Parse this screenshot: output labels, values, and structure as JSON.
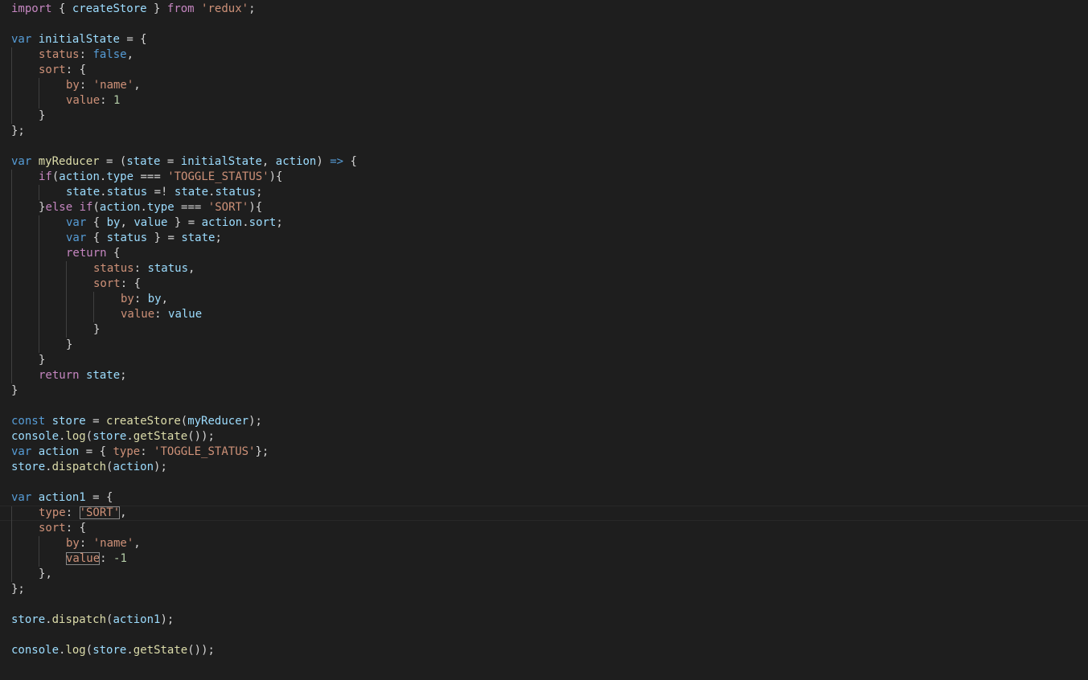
{
  "editor": {
    "colors": {
      "background": "#1e1e1e",
      "default": "#d4d4d4",
      "keyword": "#569cd6",
      "control": "#c586c0",
      "variable": "#9cdcfe",
      "function": "#dcdcaa",
      "string": "#ce9178",
      "number": "#b5cea8",
      "property": "#ce9178",
      "indent_guide": "#404040"
    },
    "current_line": 33,
    "bracket_match": {
      "line": 33,
      "token": 2
    },
    "bracket_match_end": {
      "line": 36,
      "token": 0
    },
    "lines": [
      {
        "indent": 0,
        "tokens": [
          [
            "control",
            "import"
          ],
          [
            "default",
            " { "
          ],
          [
            "variable",
            "createStore"
          ],
          [
            "default",
            " } "
          ],
          [
            "control",
            "from"
          ],
          [
            "default",
            " "
          ],
          [
            "string",
            "'redux'"
          ],
          [
            "default",
            ";"
          ]
        ]
      },
      {
        "indent": 0,
        "tokens": []
      },
      {
        "indent": 0,
        "tokens": [
          [
            "keyword",
            "var"
          ],
          [
            "default",
            " "
          ],
          [
            "variable",
            "initialState"
          ],
          [
            "default",
            " = {"
          ]
        ]
      },
      {
        "indent": 1,
        "tokens": [
          [
            "property",
            "status"
          ],
          [
            "default",
            ": "
          ],
          [
            "keyword",
            "false"
          ],
          [
            "default",
            ","
          ]
        ]
      },
      {
        "indent": 1,
        "tokens": [
          [
            "property",
            "sort"
          ],
          [
            "default",
            ": {"
          ]
        ]
      },
      {
        "indent": 2,
        "tokens": [
          [
            "property",
            "by"
          ],
          [
            "default",
            ": "
          ],
          [
            "string",
            "'name'"
          ],
          [
            "default",
            ","
          ]
        ]
      },
      {
        "indent": 2,
        "tokens": [
          [
            "property",
            "value"
          ],
          [
            "default",
            ": "
          ],
          [
            "number",
            "1"
          ]
        ]
      },
      {
        "indent": 1,
        "tokens": [
          [
            "default",
            "}"
          ]
        ]
      },
      {
        "indent": 0,
        "tokens": [
          [
            "default",
            "};"
          ]
        ]
      },
      {
        "indent": 0,
        "tokens": []
      },
      {
        "indent": 0,
        "tokens": [
          [
            "keyword",
            "var"
          ],
          [
            "default",
            " "
          ],
          [
            "function",
            "myReducer"
          ],
          [
            "default",
            " = ("
          ],
          [
            "variable",
            "state"
          ],
          [
            "default",
            " = "
          ],
          [
            "variable",
            "initialState"
          ],
          [
            "default",
            ", "
          ],
          [
            "variable",
            "action"
          ],
          [
            "default",
            ") "
          ],
          [
            "keyword",
            "=>"
          ],
          [
            "default",
            " {"
          ]
        ]
      },
      {
        "indent": 1,
        "tokens": [
          [
            "control",
            "if"
          ],
          [
            "default",
            "("
          ],
          [
            "variable",
            "action"
          ],
          [
            "default",
            "."
          ],
          [
            "variable",
            "type"
          ],
          [
            "default",
            " === "
          ],
          [
            "string",
            "'TOGGLE_STATUS'"
          ],
          [
            "default",
            "){"
          ]
        ]
      },
      {
        "indent": 2,
        "tokens": [
          [
            "variable",
            "state"
          ],
          [
            "default",
            "."
          ],
          [
            "variable",
            "status"
          ],
          [
            "default",
            " =! "
          ],
          [
            "variable",
            "state"
          ],
          [
            "default",
            "."
          ],
          [
            "variable",
            "status"
          ],
          [
            "default",
            ";"
          ]
        ]
      },
      {
        "indent": 1,
        "tokens": [
          [
            "default",
            "}"
          ],
          [
            "control",
            "else"
          ],
          [
            "default",
            " "
          ],
          [
            "control",
            "if"
          ],
          [
            "default",
            "("
          ],
          [
            "variable",
            "action"
          ],
          [
            "default",
            "."
          ],
          [
            "variable",
            "type"
          ],
          [
            "default",
            " === "
          ],
          [
            "string",
            "'SORT'"
          ],
          [
            "default",
            "){"
          ]
        ]
      },
      {
        "indent": 2,
        "tokens": [
          [
            "keyword",
            "var"
          ],
          [
            "default",
            " { "
          ],
          [
            "variable",
            "by"
          ],
          [
            "default",
            ", "
          ],
          [
            "variable",
            "value"
          ],
          [
            "default",
            " } = "
          ],
          [
            "variable",
            "action"
          ],
          [
            "default",
            "."
          ],
          [
            "variable",
            "sort"
          ],
          [
            "default",
            ";"
          ]
        ]
      },
      {
        "indent": 2,
        "tokens": [
          [
            "keyword",
            "var"
          ],
          [
            "default",
            " { "
          ],
          [
            "variable",
            "status"
          ],
          [
            "default",
            " } = "
          ],
          [
            "variable",
            "state"
          ],
          [
            "default",
            ";"
          ]
        ]
      },
      {
        "indent": 2,
        "tokens": [
          [
            "control",
            "return"
          ],
          [
            "default",
            " {"
          ]
        ]
      },
      {
        "indent": 3,
        "tokens": [
          [
            "property",
            "status"
          ],
          [
            "default",
            ": "
          ],
          [
            "variable",
            "status"
          ],
          [
            "default",
            ","
          ]
        ]
      },
      {
        "indent": 3,
        "tokens": [
          [
            "property",
            "sort"
          ],
          [
            "default",
            ": {"
          ]
        ]
      },
      {
        "indent": 4,
        "tokens": [
          [
            "property",
            "by"
          ],
          [
            "default",
            ": "
          ],
          [
            "variable",
            "by"
          ],
          [
            "default",
            ","
          ]
        ]
      },
      {
        "indent": 4,
        "tokens": [
          [
            "property",
            "value"
          ],
          [
            "default",
            ": "
          ],
          [
            "variable",
            "value"
          ]
        ]
      },
      {
        "indent": 3,
        "tokens": [
          [
            "default",
            "}"
          ]
        ]
      },
      {
        "indent": 2,
        "tokens": [
          [
            "default",
            "}"
          ]
        ]
      },
      {
        "indent": 1,
        "tokens": [
          [
            "default",
            "}"
          ]
        ]
      },
      {
        "indent": 1,
        "tokens": [
          [
            "control",
            "return"
          ],
          [
            "default",
            " "
          ],
          [
            "variable",
            "state"
          ],
          [
            "default",
            ";"
          ]
        ]
      },
      {
        "indent": 0,
        "tokens": [
          [
            "default",
            "}"
          ]
        ]
      },
      {
        "indent": 0,
        "tokens": []
      },
      {
        "indent": 0,
        "tokens": [
          [
            "keyword",
            "const"
          ],
          [
            "default",
            " "
          ],
          [
            "variable",
            "store"
          ],
          [
            "default",
            " = "
          ],
          [
            "function",
            "createStore"
          ],
          [
            "default",
            "("
          ],
          [
            "variable",
            "myReducer"
          ],
          [
            "default",
            ");"
          ]
        ]
      },
      {
        "indent": 0,
        "tokens": [
          [
            "variable",
            "console"
          ],
          [
            "default",
            "."
          ],
          [
            "function",
            "log"
          ],
          [
            "default",
            "("
          ],
          [
            "variable",
            "store"
          ],
          [
            "default",
            "."
          ],
          [
            "function",
            "getState"
          ],
          [
            "default",
            "());"
          ]
        ]
      },
      {
        "indent": 0,
        "tokens": [
          [
            "keyword",
            "var"
          ],
          [
            "default",
            " "
          ],
          [
            "variable",
            "action"
          ],
          [
            "default",
            " = { "
          ],
          [
            "property",
            "type"
          ],
          [
            "default",
            ": "
          ],
          [
            "string",
            "'TOGGLE_STATUS'"
          ],
          [
            "default",
            "};"
          ]
        ]
      },
      {
        "indent": 0,
        "tokens": [
          [
            "variable",
            "store"
          ],
          [
            "default",
            "."
          ],
          [
            "function",
            "dispatch"
          ],
          [
            "default",
            "("
          ],
          [
            "variable",
            "action"
          ],
          [
            "default",
            ");"
          ]
        ]
      },
      {
        "indent": 0,
        "tokens": []
      },
      {
        "indent": 0,
        "tokens": [
          [
            "keyword",
            "var"
          ],
          [
            "default",
            " "
          ],
          [
            "variable",
            "action1"
          ],
          [
            "default",
            " = {"
          ]
        ]
      },
      {
        "indent": 1,
        "tokens": [
          [
            "property",
            "type"
          ],
          [
            "default",
            ": "
          ],
          [
            "string",
            "'SORT'"
          ],
          [
            "default",
            ","
          ]
        ]
      },
      {
        "indent": 1,
        "tokens": [
          [
            "property",
            "sort"
          ],
          [
            "default",
            ": "
          ],
          [
            "default",
            "{"
          ]
        ]
      },
      {
        "indent": 2,
        "tokens": [
          [
            "property",
            "by"
          ],
          [
            "default",
            ": "
          ],
          [
            "string",
            "'name'"
          ],
          [
            "default",
            ","
          ]
        ]
      },
      {
        "indent": 2,
        "tokens": [
          [
            "property",
            "value"
          ],
          [
            "default",
            ": "
          ],
          [
            "number",
            "-1"
          ]
        ]
      },
      {
        "indent": 1,
        "tokens": [
          [
            "default",
            "}"
          ],
          [
            "default",
            ","
          ]
        ]
      },
      {
        "indent": 0,
        "tokens": [
          [
            "default",
            "};"
          ]
        ]
      },
      {
        "indent": 0,
        "tokens": []
      },
      {
        "indent": 0,
        "tokens": [
          [
            "variable",
            "store"
          ],
          [
            "default",
            "."
          ],
          [
            "function",
            "dispatch"
          ],
          [
            "default",
            "("
          ],
          [
            "variable",
            "action1"
          ],
          [
            "default",
            ");"
          ]
        ]
      },
      {
        "indent": 0,
        "tokens": []
      },
      {
        "indent": 0,
        "tokens": [
          [
            "variable",
            "console"
          ],
          [
            "default",
            "."
          ],
          [
            "function",
            "log"
          ],
          [
            "default",
            "("
          ],
          [
            "variable",
            "store"
          ],
          [
            "default",
            "."
          ],
          [
            "function",
            "getState"
          ],
          [
            "default",
            "());"
          ]
        ]
      }
    ]
  }
}
